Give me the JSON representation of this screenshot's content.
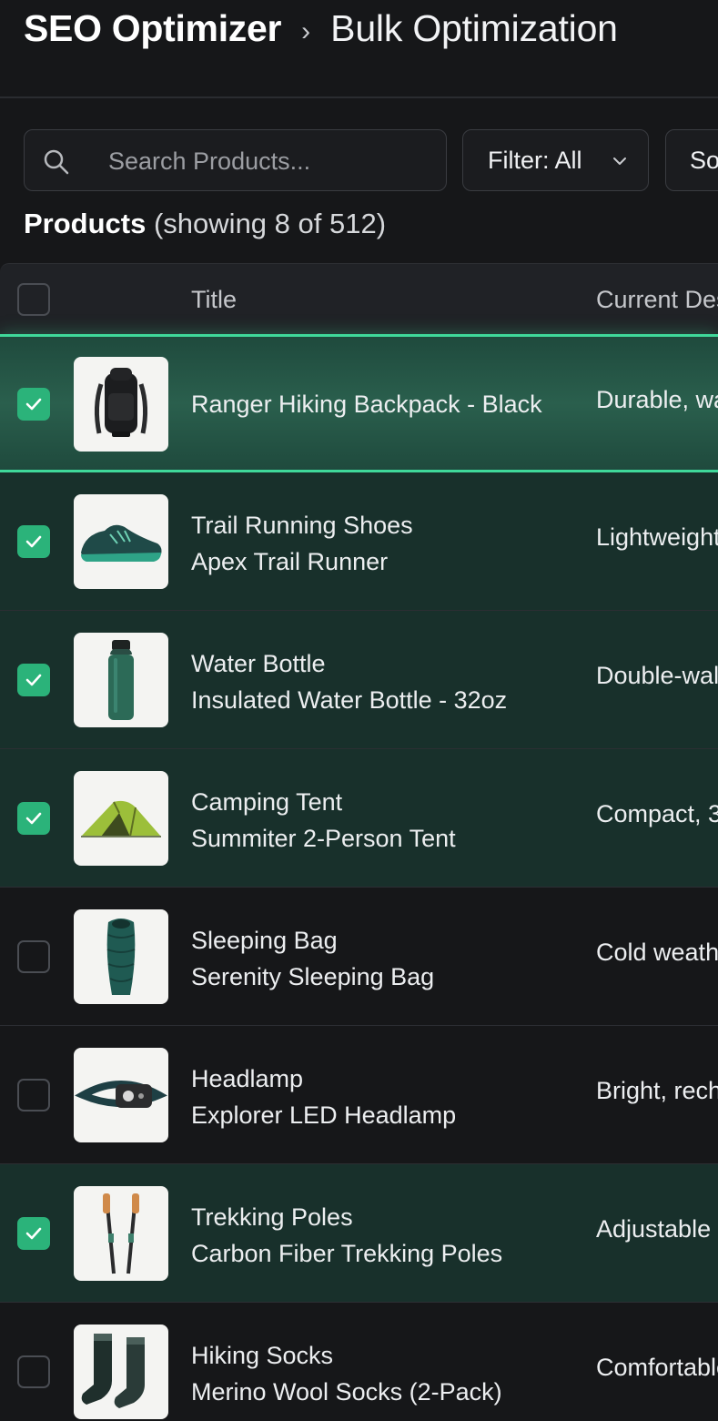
{
  "breadcrumb": {
    "root": "SEO Optimizer",
    "separator": "›",
    "current": "Bulk Optimization"
  },
  "toolbar": {
    "search_placeholder": "Search Products...",
    "filter_label": "Filter: All",
    "sort_label": "Sort"
  },
  "products_header": {
    "label": "Products",
    "count_text": "(showing 8 of 512)"
  },
  "table": {
    "columns": {
      "title": "Title",
      "description": "Current Description"
    },
    "select_all_checked": false
  },
  "rows": [
    {
      "line1": "Ranger Hiking Backpack - Black",
      "line2": "",
      "desc": "Durable, water-resistant",
      "checked": true,
      "thumb": "backpack-icon"
    },
    {
      "line1": "Trail Running Shoes",
      "line2": "Apex Trail Runner",
      "desc": "Lightweight",
      "checked": true,
      "thumb": "shoe-icon"
    },
    {
      "line1": "Water Bottle",
      "line2": "Insulated Water Bottle - 32oz",
      "desc": "Double-wall",
      "checked": true,
      "thumb": "bottle-icon"
    },
    {
      "line1": "Camping Tent",
      "line2": "Summiter 2-Person Tent",
      "desc": "Compact, 3",
      "checked": true,
      "thumb": "tent-icon"
    },
    {
      "line1": "Sleeping Bag",
      "line2": "Serenity Sleeping Bag",
      "desc": "Cold weather",
      "checked": false,
      "thumb": "sleeping-bag-icon"
    },
    {
      "line1": "Headlamp",
      "line2": "Explorer LED Headlamp",
      "desc": "Bright, rechargeable",
      "checked": false,
      "thumb": "headlamp-icon"
    },
    {
      "line1": "Trekking Poles",
      "line2": "Carbon Fiber Trekking Poles",
      "desc": "Adjustable",
      "checked": true,
      "thumb": "trekking-poles-icon"
    },
    {
      "line1": "Hiking Socks",
      "line2": "Merino Wool Socks (2-Pack)",
      "desc": "Comfortable",
      "checked": false,
      "thumb": "socks-icon"
    }
  ],
  "colors": {
    "accent": "#2bb37a",
    "background": "#161719",
    "selected_row": "#18302b"
  }
}
